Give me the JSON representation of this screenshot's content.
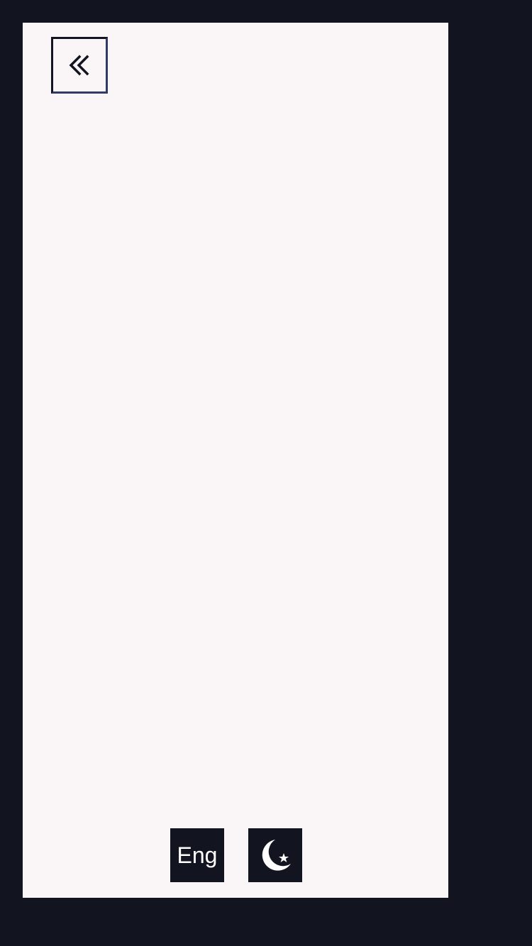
{
  "colors": {
    "backdrop": "#121420",
    "drawer_bg": "#faf5f7",
    "button_bg": "#121420",
    "button_fg": "#ffffff",
    "accent_border": "#343a66"
  },
  "drawer": {
    "collapse_icon": "chevrons-left-icon",
    "language_label": "Eng",
    "theme_icon": "moon-star-icon"
  }
}
